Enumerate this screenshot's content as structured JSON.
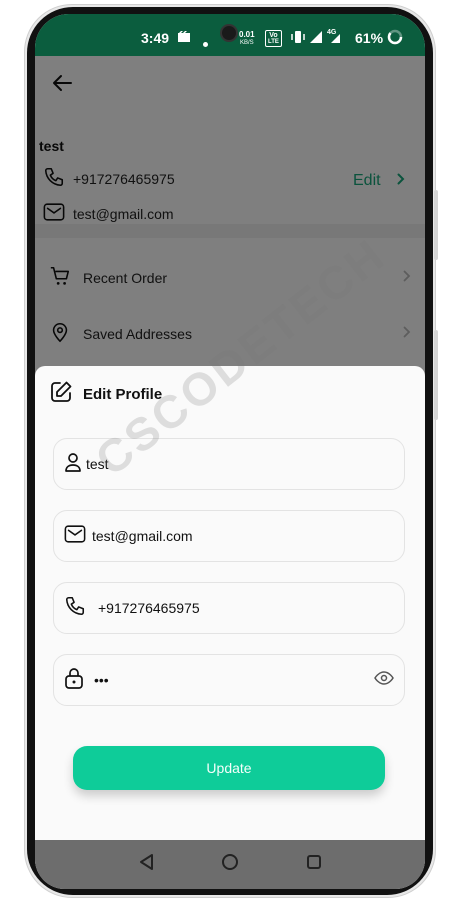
{
  "status_bar": {
    "time": "3:49",
    "net_speed_value": "0.01",
    "net_speed_unit": "KB/S",
    "volte_top": "Vo",
    "volte_bottom": "LTE",
    "signal_label": "4G",
    "battery": "61%"
  },
  "profile": {
    "name": "test",
    "phone": "+917276465975",
    "email": "test@gmail.com",
    "edit_label": "Edit"
  },
  "menu": {
    "items": [
      {
        "label": "Recent Order",
        "icon": "cart-icon"
      },
      {
        "label": "Saved Addresses",
        "icon": "location-pin-icon"
      }
    ]
  },
  "edit_sheet": {
    "title": "Edit Profile",
    "name_value": "test",
    "email_value": "test@gmail.com",
    "phone_value": "+917276465975",
    "password_value": "•••",
    "update_label": "Update"
  },
  "watermark": "CSCODETECH",
  "colors": {
    "status_bar": "#0b5d3e",
    "accent": "#0ecc99",
    "edit_link": "#17a67a"
  }
}
